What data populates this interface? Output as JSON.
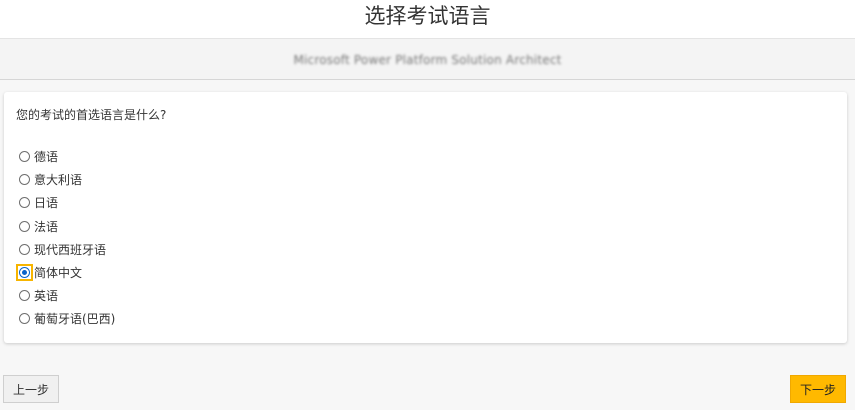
{
  "header": {
    "title": "选择考试语言",
    "exam_name": "Microsoft Power Platform Solution Architect"
  },
  "question": {
    "prompt": "您的考试的首选语言是什么?",
    "options": [
      {
        "label": "德语",
        "selected": false
      },
      {
        "label": "意大利语",
        "selected": false
      },
      {
        "label": "日语",
        "selected": false
      },
      {
        "label": "法语",
        "selected": false
      },
      {
        "label": "现代西班牙语",
        "selected": false
      },
      {
        "label": "简体中文",
        "selected": true
      },
      {
        "label": "英语",
        "selected": false
      },
      {
        "label": "葡萄牙语(巴西)",
        "selected": false
      }
    ]
  },
  "buttons": {
    "prev_label": "上一步",
    "next_label": "下一步"
  },
  "colors": {
    "accent": "#ffb900",
    "radio_selected": "#0a63c9",
    "focus_ring": "#f7b500"
  }
}
